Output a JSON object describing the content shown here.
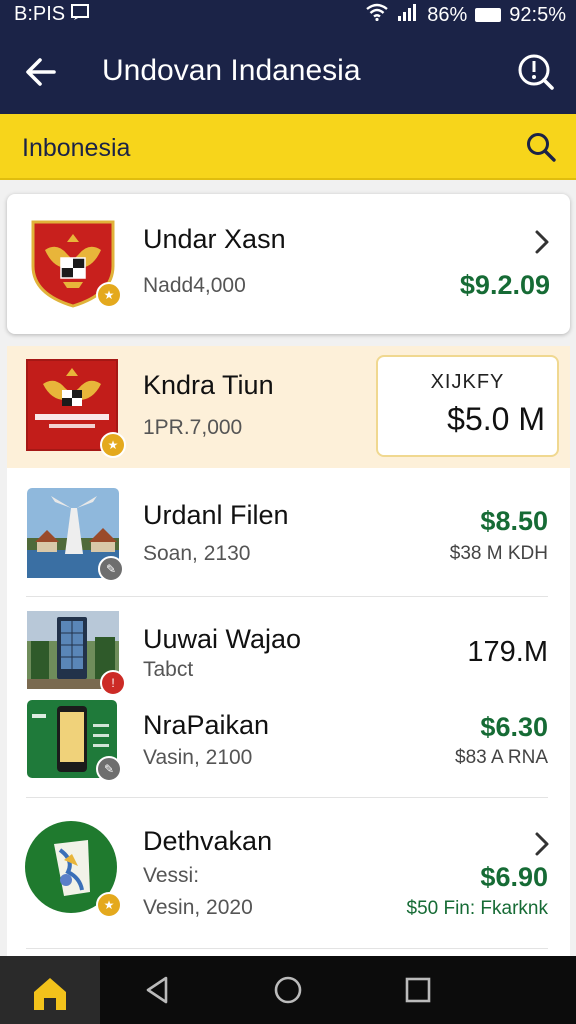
{
  "status_bar": {
    "left_text": "B:PIS",
    "battery_percent": "86%",
    "time": "92:5%"
  },
  "app_bar": {
    "title": "Undovan Indanesia"
  },
  "search": {
    "text": "Inbonesia"
  },
  "items": [
    {
      "name": "Undar Xasn",
      "sub": "Nadd4,000",
      "price": "$9.2.09"
    },
    {
      "name": "Kndra Tiun",
      "sub": "1PR.7,000",
      "box_label": "XIJKFY",
      "box_value": "$5.0 M"
    },
    {
      "name": "Urdanl Filen",
      "sub": "Soan, 2130",
      "price": "$8.50",
      "sub_right": "$38 M KDH"
    },
    {
      "name": "Uuwai Wajao",
      "sub": "Tabct",
      "price": "179.M"
    },
    {
      "name": "NraPaikan",
      "sub": "Vasin, 2100",
      "price": "$6.30",
      "sub_right": "$83 A RNA"
    },
    {
      "name": "Dethvakan",
      "sub": "Vessi:",
      "sub2": "Vesin, 2020",
      "price": "$6.90",
      "sub_right": "$50 Fin: Fkarknk"
    }
  ],
  "colors": {
    "header": "#1b2347",
    "accent_yellow": "#f7d51b",
    "price_green": "#166b35"
  }
}
